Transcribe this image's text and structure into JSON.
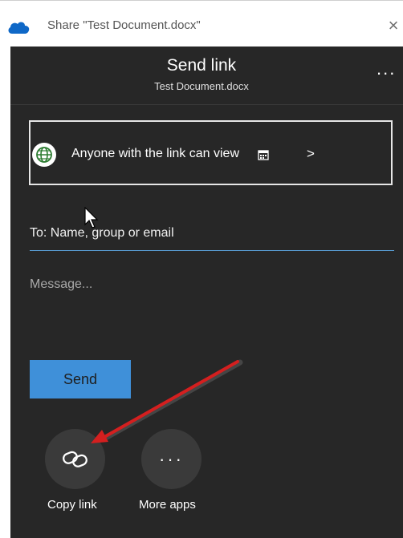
{
  "window": {
    "title": "Share \"Test Document.docx\"",
    "close_glyph": "×",
    "icon": "onedrive-cloud-icon",
    "close_icon": "close-icon"
  },
  "header": {
    "title": "Send link",
    "subtitle": "Test Document.docx",
    "more_glyph": "..."
  },
  "link_settings": {
    "label": "Anyone with the link can view",
    "icon": "globe-icon",
    "expiry_icon": "calendar-icon",
    "chevron": ">"
  },
  "to_field": {
    "placeholder": "To: Name, group or email"
  },
  "message_field": {
    "placeholder": "Message..."
  },
  "send_button": {
    "label": "Send"
  },
  "actions": [
    {
      "label": "Copy link",
      "icon": "link-icon"
    },
    {
      "label": "More apps",
      "icon": "more-dots-icon",
      "glyph": "···"
    }
  ],
  "colors": {
    "panel_bg": "#272727",
    "accent": "#3f90d9",
    "annotation_arrow": "#d41f1f",
    "globe_green": "#2e7d32"
  }
}
